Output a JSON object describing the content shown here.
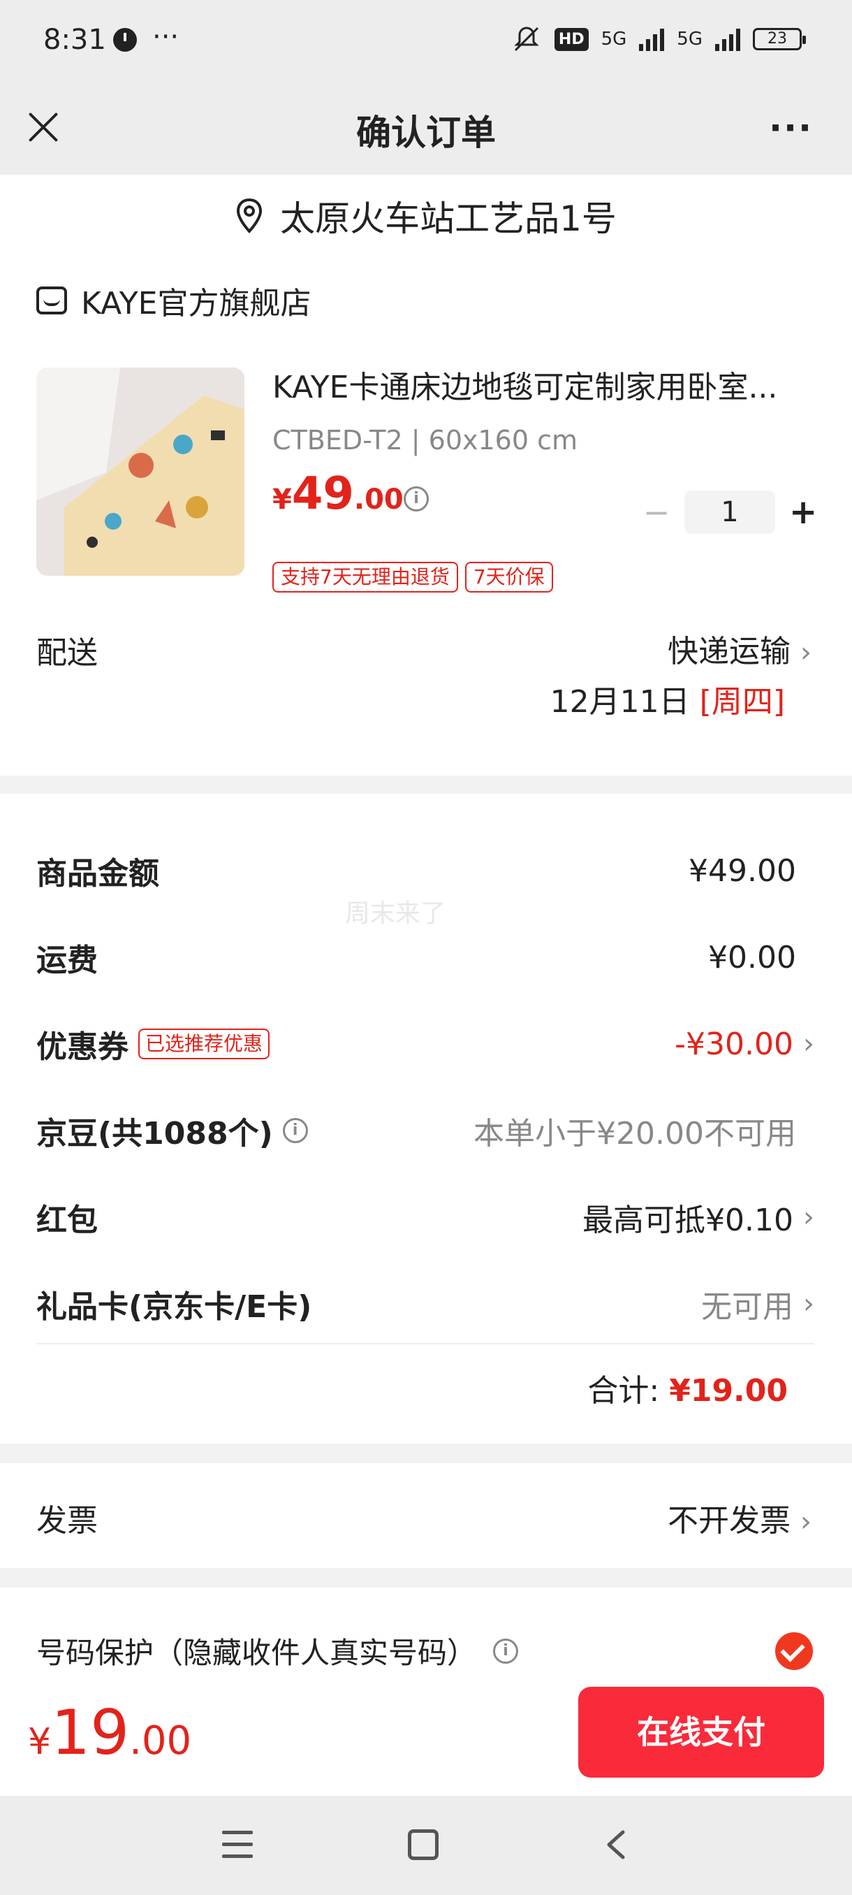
{
  "status_bar": {
    "time": "8:31",
    "dots": "···",
    "hd_badge": "HD",
    "net1": "5G",
    "net2": "5G",
    "battery": "23"
  },
  "header": {
    "title": "确认订单",
    "more": "···"
  },
  "address": {
    "text": "太原火车站工艺品1号"
  },
  "shop": {
    "name": "KAYE官方旗舰店"
  },
  "product": {
    "title": "KAYE卡通床边地毯可定制家用卧室...",
    "spec": "CTBED-T2 | 60x160 cm",
    "price_currency": "¥",
    "price_int": "49",
    "price_dec": ".00",
    "quantity": "1",
    "minus": "−",
    "plus": "+",
    "tags": [
      "支持7天无理由退货",
      "7天价保"
    ]
  },
  "delivery": {
    "label": "配送",
    "method": "快递运输",
    "date": "12月11日",
    "weekday": "[周四]"
  },
  "summary": {
    "goods_label": "商品金额",
    "goods_value": "¥49.00",
    "shipping_label": "运费",
    "shipping_value": "¥0.00",
    "coupon_label": "优惠券",
    "coupon_tag": "已选推荐优惠",
    "coupon_value": "-¥30.00",
    "beans_label": "京豆(共1088个)",
    "beans_value": "本单小于¥20.00不可用",
    "redpacket_label": "红包",
    "redpacket_value": "最高可抵¥0.10",
    "giftcard_label": "礼品卡(京东卡/E卡)",
    "giftcard_value": "无可用",
    "total_label": "合计:",
    "total_value": "¥19.00",
    "watermark": "周末来了"
  },
  "invoice": {
    "label": "发票",
    "value": "不开发票"
  },
  "protection": {
    "label": "号码保护（隐藏收件人真实号码）"
  },
  "footer": {
    "price_currency": "¥",
    "price_int": "19",
    "price_dec": ".00",
    "pay_button": "在线支付"
  },
  "colors": {
    "accent_red": "#e2231a",
    "pay_button": "#f92a3a"
  }
}
